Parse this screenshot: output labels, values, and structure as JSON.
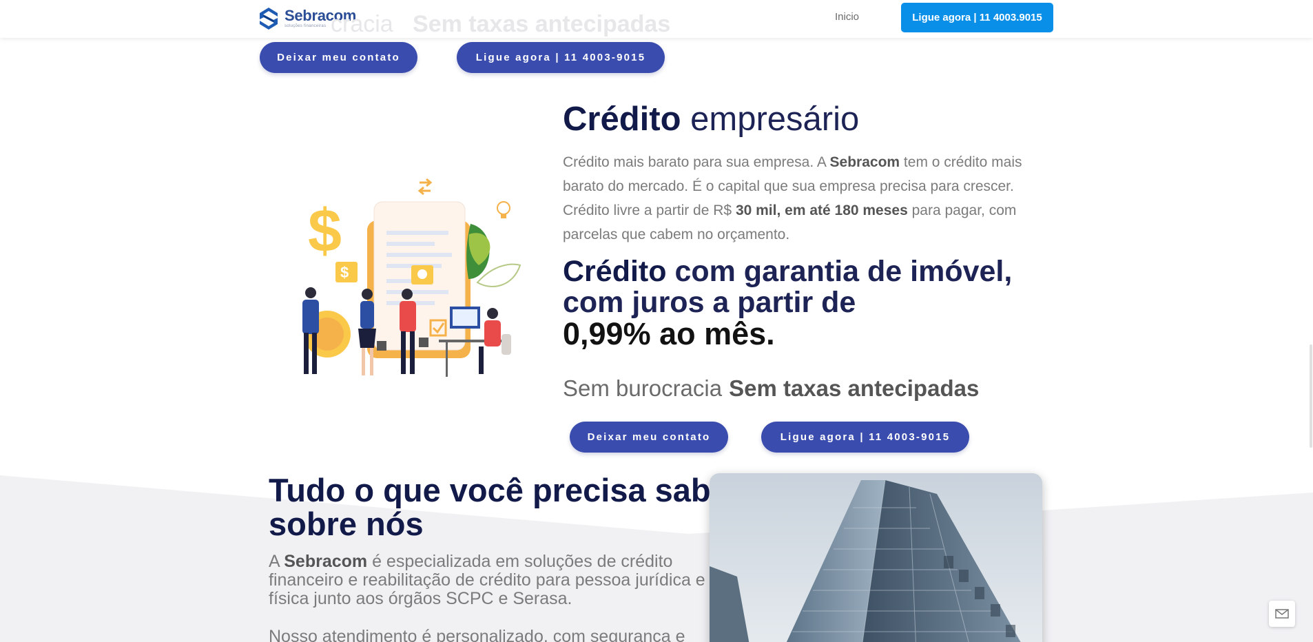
{
  "nav": {
    "logo_name": "Sebracom",
    "logo_tagline": "soluções financeiras",
    "home_link": "Inicio",
    "cta": "Ligue agora | 11 4003.9015"
  },
  "ghost_row": {
    "left_text": "cracia",
    "right_text": "Sem taxas antecipadas"
  },
  "top_buttons": {
    "contact": "Deixar meu contato",
    "call": "Ligue agora | 11 4003-9015"
  },
  "hero": {
    "title_bold": "Crédito",
    "title_rest": "empresário",
    "para_1": "Crédito mais barato para sua empresa. A ",
    "para_brand": "Sebracom",
    "para_2": " tem o crédito mais barato do mercado. É o capital que sua empresa precisa para crescer. Crédito livre a partir de R$ ",
    "para_amount": "30 mil, em até 180 meses",
    "para_3": " para pagar, com parcelas que cabem no orçamento.",
    "h2_bold": "Crédito",
    "h2_rest": " com garantia de imóvel, com juros a partir de",
    "rate": "0,99% ao mês.",
    "tag_1": "Sem burocracia",
    "tag_2": "Sem taxas antecipadas"
  },
  "hero_buttons": {
    "contact": "Deixar meu contato",
    "call": "Ligue agora | 11 4003-9015"
  },
  "about": {
    "title_line1": "Tudo o que você precisa saber",
    "title_bold": "sobre nós",
    "para_prefix": "A ",
    "para_brand": "Sebracom",
    "para_rest": " é especializada em soluções de crédito financeiro e reabilitação de crédito para pessoa jurídica e física junto aos órgãos SCPC e Serasa.",
    "para2": "Nosso atendimento é personalizado, com segurança e"
  },
  "colors": {
    "primary_button": "#3a4cad",
    "nav_cta": "#0a8fe8",
    "heading_navy": "#121a4a"
  },
  "icons": {
    "chat": "envelope-icon",
    "logo": "sebracom-s-logo"
  }
}
